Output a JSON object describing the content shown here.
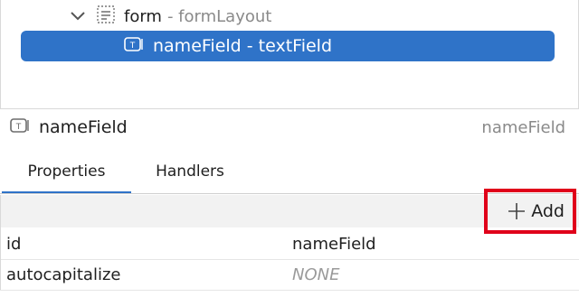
{
  "tree": {
    "form_node": {
      "name": "form",
      "type": "- formLayout",
      "icon": "form-layout-icon",
      "expand_icon": "chevron-down-icon"
    },
    "selected_node": {
      "label": "nameField - textField",
      "icon": "text-field-icon"
    }
  },
  "component": {
    "name": "nameField",
    "id_right": "nameField",
    "icon": "text-field-icon"
  },
  "tabs": [
    {
      "label": "Properties",
      "active": true
    },
    {
      "label": "Handlers",
      "active": false
    }
  ],
  "toolbar": {
    "add_label": "Add",
    "add_icon": "plus-icon"
  },
  "properties": [
    {
      "name": "id",
      "value": "nameField",
      "muted": false
    },
    {
      "name": "autocapitalize",
      "value": "NONE",
      "muted": true
    }
  ],
  "colors": {
    "selection": "#2f73c8",
    "highlight_border": "#e0001a",
    "muted_text": "#8a8a8a"
  }
}
